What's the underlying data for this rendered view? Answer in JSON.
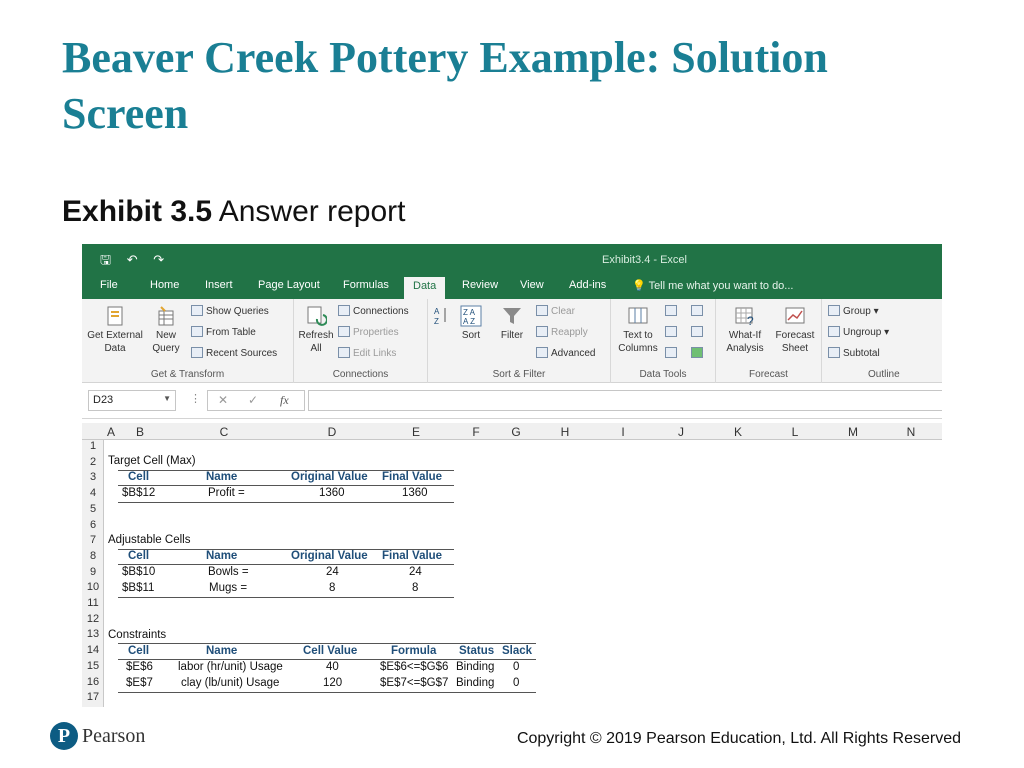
{
  "slide": {
    "title": "Beaver Creek Pottery Example: Solution Screen",
    "exhibit_num": "Exhibit 3.5",
    "exhibit_text": "Answer report",
    "copyright": "Copyright © 2019 Pearson Education, Ltd. All Rights Reserved",
    "logo_text": "Pearson"
  },
  "excel": {
    "window_title": "Exhibit3.4 - Excel",
    "tabs": [
      "File",
      "Home",
      "Insert",
      "Page Layout",
      "Formulas",
      "Data",
      "Review",
      "View",
      "Add-ins"
    ],
    "active_tab": "Data",
    "tell_me": "Tell me what you want to do...",
    "ribbon": {
      "get_external": "Get External Data",
      "new_query": "New Query",
      "show_queries": "Show Queries",
      "from_table": "From Table",
      "recent_sources": "Recent Sources",
      "group_get_transform": "Get & Transform",
      "refresh_all": "Refresh All",
      "connections": "Connections",
      "properties": "Properties",
      "edit_links": "Edit Links",
      "group_connections": "Connections",
      "sort": "Sort",
      "filter": "Filter",
      "clear": "Clear",
      "reapply": "Reapply",
      "advanced": "Advanced",
      "group_sort_filter": "Sort & Filter",
      "text_to_columns": "Text to Columns",
      "group_data_tools": "Data Tools",
      "what_if": "What-If Analysis",
      "forecast_sheet": "Forecast Sheet",
      "group_forecast": "Forecast",
      "group_btn": "Group",
      "ungroup": "Ungroup",
      "subtotal": "Subtotal",
      "group_outline": "Outline"
    },
    "name_box": "D23",
    "formula_icon": "fx",
    "columns": [
      "A",
      "B",
      "C",
      "D",
      "E",
      "F",
      "G",
      "H",
      "I",
      "J",
      "K",
      "L",
      "M",
      "N"
    ],
    "rows": [
      "1",
      "2",
      "3",
      "4",
      "5",
      "6",
      "7",
      "8",
      "9",
      "10",
      "11",
      "12",
      "13",
      "14",
      "15",
      "16",
      "17"
    ],
    "report": {
      "target_label": "Target Cell (Max)",
      "target_headers": [
        "Cell",
        "Name",
        "Original Value",
        "Final Value"
      ],
      "target_row": [
        "$B$12",
        "Profit =",
        "1360",
        "1360"
      ],
      "adjustable_label": "Adjustable Cells",
      "adjustable_headers": [
        "Cell",
        "Name",
        "Original Value",
        "Final Value"
      ],
      "adjustable_rows": [
        [
          "$B$10",
          "Bowls =",
          "24",
          "24"
        ],
        [
          "$B$11",
          "Mugs =",
          "8",
          "8"
        ]
      ],
      "constraints_label": "Constraints",
      "constraints_headers": [
        "Cell",
        "Name",
        "Cell Value",
        "Formula",
        "Status",
        "Slack"
      ],
      "constraints_rows": [
        [
          "$E$6",
          "labor (hr/unit) Usage",
          "40",
          "$E$6<=$G$6",
          "Binding",
          "0"
        ],
        [
          "$E$7",
          "clay (lb/unit) Usage",
          "120",
          "$E$7<=$G$7",
          "Binding",
          "0"
        ]
      ]
    }
  }
}
